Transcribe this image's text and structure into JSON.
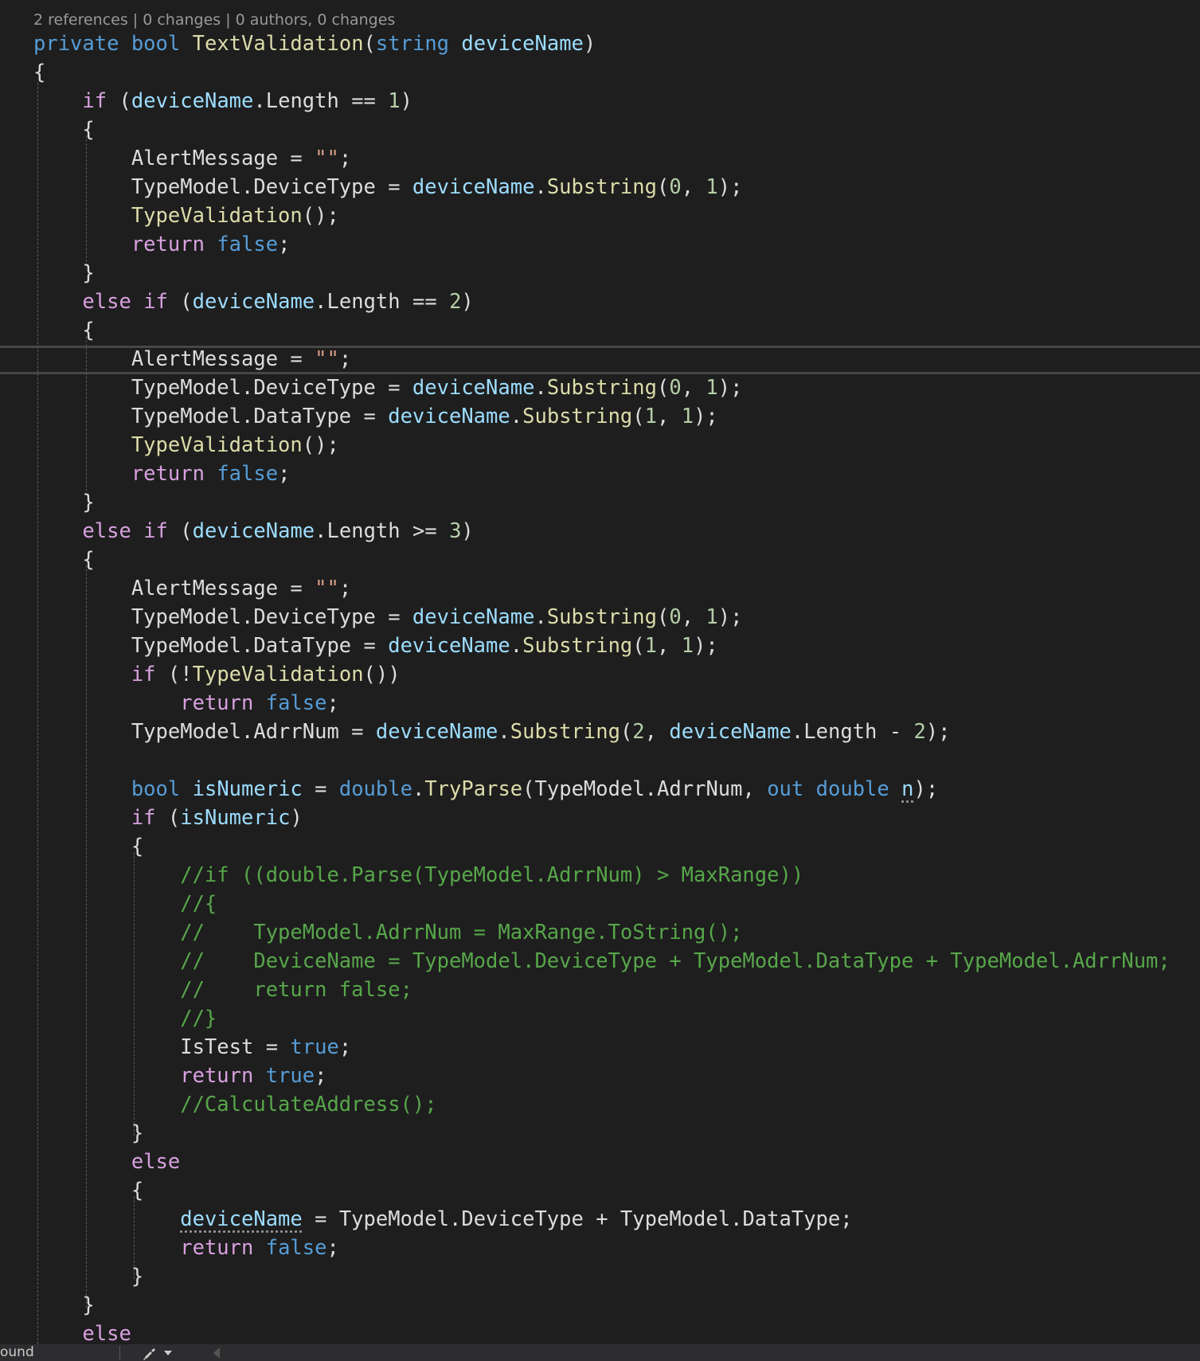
{
  "codelens": {
    "text": "2 references | 0 changes | 0 authors, 0 changes"
  },
  "code": {
    "lines": [
      [
        [
          "private",
          "k-blue"
        ],
        [
          " ",
          "k-plain"
        ],
        [
          "bool",
          "k-blue"
        ],
        [
          " ",
          "k-plain"
        ],
        [
          "TextValidation",
          "k-fn"
        ],
        [
          "(",
          "k-plain"
        ],
        [
          "string",
          "k-blue"
        ],
        [
          " ",
          "k-plain"
        ],
        [
          "deviceName",
          "k-var"
        ],
        [
          ")",
          "k-plain"
        ]
      ],
      [
        [
          "{",
          "k-plain"
        ]
      ],
      [
        [
          "    ",
          "k-plain"
        ],
        [
          "if",
          "k-purple"
        ],
        [
          " (",
          "k-plain"
        ],
        [
          "deviceName",
          "k-var"
        ],
        [
          ".Length == ",
          "k-plain"
        ],
        [
          "1",
          "k-num"
        ],
        [
          ")",
          "k-plain"
        ]
      ],
      [
        [
          "    {",
          "k-plain"
        ]
      ],
      [
        [
          "        AlertMessage = ",
          "k-plain"
        ],
        [
          "\"\"",
          "k-str"
        ],
        [
          ";",
          "k-plain"
        ]
      ],
      [
        [
          "        TypeModel.DeviceType = ",
          "k-plain"
        ],
        [
          "deviceName",
          "k-var"
        ],
        [
          ".",
          "k-plain"
        ],
        [
          "Substring",
          "k-fn"
        ],
        [
          "(",
          "k-plain"
        ],
        [
          "0",
          "k-num"
        ],
        [
          ", ",
          "k-plain"
        ],
        [
          "1",
          "k-num"
        ],
        [
          ");",
          "k-plain"
        ]
      ],
      [
        [
          "        ",
          "k-plain"
        ],
        [
          "TypeValidation",
          "k-fn"
        ],
        [
          "();",
          "k-plain"
        ]
      ],
      [
        [
          "        ",
          "k-plain"
        ],
        [
          "return",
          "k-purple"
        ],
        [
          " ",
          "k-plain"
        ],
        [
          "false",
          "k-blue"
        ],
        [
          ";",
          "k-plain"
        ]
      ],
      [
        [
          "    }",
          "k-plain"
        ]
      ],
      [
        [
          "    ",
          "k-plain"
        ],
        [
          "else",
          "k-purple"
        ],
        [
          " ",
          "k-plain"
        ],
        [
          "if",
          "k-purple"
        ],
        [
          " (",
          "k-plain"
        ],
        [
          "deviceName",
          "k-var"
        ],
        [
          ".Length == ",
          "k-plain"
        ],
        [
          "2",
          "k-num"
        ],
        [
          ")",
          "k-plain"
        ]
      ],
      [
        [
          "    {",
          "k-plain"
        ]
      ],
      [
        [
          "        AlertMessage = ",
          "k-plain"
        ],
        [
          "\"\"",
          "k-str"
        ],
        [
          ";",
          "k-plain"
        ]
      ],
      [
        [
          "        TypeModel.DeviceType = ",
          "k-plain"
        ],
        [
          "deviceName",
          "k-var"
        ],
        [
          ".",
          "k-plain"
        ],
        [
          "Substring",
          "k-fn"
        ],
        [
          "(",
          "k-plain"
        ],
        [
          "0",
          "k-num"
        ],
        [
          ", ",
          "k-plain"
        ],
        [
          "1",
          "k-num"
        ],
        [
          ");",
          "k-plain"
        ]
      ],
      [
        [
          "        TypeModel.DataType = ",
          "k-plain"
        ],
        [
          "deviceName",
          "k-var"
        ],
        [
          ".",
          "k-plain"
        ],
        [
          "Substring",
          "k-fn"
        ],
        [
          "(",
          "k-plain"
        ],
        [
          "1",
          "k-num"
        ],
        [
          ", ",
          "k-plain"
        ],
        [
          "1",
          "k-num"
        ],
        [
          ");",
          "k-plain"
        ]
      ],
      [
        [
          "        ",
          "k-plain"
        ],
        [
          "TypeValidation",
          "k-fn"
        ],
        [
          "();",
          "k-plain"
        ]
      ],
      [
        [
          "        ",
          "k-plain"
        ],
        [
          "return",
          "k-purple"
        ],
        [
          " ",
          "k-plain"
        ],
        [
          "false",
          "k-blue"
        ],
        [
          ";",
          "k-plain"
        ]
      ],
      [
        [
          "    }",
          "k-plain"
        ]
      ],
      [
        [
          "    ",
          "k-plain"
        ],
        [
          "else",
          "k-purple"
        ],
        [
          " ",
          "k-plain"
        ],
        [
          "if",
          "k-purple"
        ],
        [
          " (",
          "k-plain"
        ],
        [
          "deviceName",
          "k-var"
        ],
        [
          ".Length >= ",
          "k-plain"
        ],
        [
          "3",
          "k-num"
        ],
        [
          ")",
          "k-plain"
        ]
      ],
      [
        [
          "    {",
          "k-plain"
        ]
      ],
      [
        [
          "        AlertMessage = ",
          "k-plain"
        ],
        [
          "\"\"",
          "k-str"
        ],
        [
          ";",
          "k-plain"
        ]
      ],
      [
        [
          "        TypeModel.DeviceType = ",
          "k-plain"
        ],
        [
          "deviceName",
          "k-var"
        ],
        [
          ".",
          "k-plain"
        ],
        [
          "Substring",
          "k-fn"
        ],
        [
          "(",
          "k-plain"
        ],
        [
          "0",
          "k-num"
        ],
        [
          ", ",
          "k-plain"
        ],
        [
          "1",
          "k-num"
        ],
        [
          ");",
          "k-plain"
        ]
      ],
      [
        [
          "        TypeModel.DataType = ",
          "k-plain"
        ],
        [
          "deviceName",
          "k-var"
        ],
        [
          ".",
          "k-plain"
        ],
        [
          "Substring",
          "k-fn"
        ],
        [
          "(",
          "k-plain"
        ],
        [
          "1",
          "k-num"
        ],
        [
          ", ",
          "k-plain"
        ],
        [
          "1",
          "k-num"
        ],
        [
          ");",
          "k-plain"
        ]
      ],
      [
        [
          "        ",
          "k-plain"
        ],
        [
          "if",
          "k-purple"
        ],
        [
          " (!",
          "k-plain"
        ],
        [
          "TypeValidation",
          "k-fn"
        ],
        [
          "())",
          "k-plain"
        ]
      ],
      [
        [
          "            ",
          "k-plain"
        ],
        [
          "return",
          "k-purple"
        ],
        [
          " ",
          "k-plain"
        ],
        [
          "false",
          "k-blue"
        ],
        [
          ";",
          "k-plain"
        ]
      ],
      [
        [
          "        TypeModel.AdrrNum = ",
          "k-plain"
        ],
        [
          "deviceName",
          "k-var"
        ],
        [
          ".",
          "k-plain"
        ],
        [
          "Substring",
          "k-fn"
        ],
        [
          "(",
          "k-plain"
        ],
        [
          "2",
          "k-num"
        ],
        [
          ", ",
          "k-plain"
        ],
        [
          "deviceName",
          "k-var"
        ],
        [
          ".Length - ",
          "k-plain"
        ],
        [
          "2",
          "k-num"
        ],
        [
          ");",
          "k-plain"
        ]
      ],
      [
        [
          "",
          "k-plain"
        ]
      ],
      [
        [
          "        ",
          "k-plain"
        ],
        [
          "bool",
          "k-blue"
        ],
        [
          " ",
          "k-plain"
        ],
        [
          "isNumeric",
          "k-var"
        ],
        [
          " = ",
          "k-plain"
        ],
        [
          "double",
          "k-blue"
        ],
        [
          ".",
          "k-plain"
        ],
        [
          "TryParse",
          "k-fn"
        ],
        [
          "(TypeModel.AdrrNum, ",
          "k-plain"
        ],
        [
          "out",
          "k-blue"
        ],
        [
          " ",
          "k-plain"
        ],
        [
          "double",
          "k-blue"
        ],
        [
          " ",
          "k-plain"
        ],
        [
          "n",
          "k-var squiggle"
        ],
        [
          ");",
          "k-plain"
        ]
      ],
      [
        [
          "        ",
          "k-plain"
        ],
        [
          "if",
          "k-purple"
        ],
        [
          " (",
          "k-plain"
        ],
        [
          "isNumeric",
          "k-var"
        ],
        [
          ")",
          "k-plain"
        ]
      ],
      [
        [
          "        {",
          "k-plain"
        ]
      ],
      [
        [
          "            //if ((double.Parse(TypeModel.AdrrNum) > MaxRange))",
          "k-cmt"
        ]
      ],
      [
        [
          "            //{",
          "k-cmt"
        ]
      ],
      [
        [
          "            //    TypeModel.AdrrNum = MaxRange.ToString();",
          "k-cmt"
        ]
      ],
      [
        [
          "            //    DeviceName = TypeModel.DeviceType + TypeModel.DataType + TypeModel.AdrrNum;",
          "k-cmt"
        ]
      ],
      [
        [
          "            //    return false;",
          "k-cmt"
        ]
      ],
      [
        [
          "            //}",
          "k-cmt"
        ]
      ],
      [
        [
          "            IsTest = ",
          "k-plain"
        ],
        [
          "true",
          "k-blue"
        ],
        [
          ";",
          "k-plain"
        ]
      ],
      [
        [
          "            ",
          "k-plain"
        ],
        [
          "return",
          "k-purple"
        ],
        [
          " ",
          "k-plain"
        ],
        [
          "true",
          "k-blue"
        ],
        [
          ";",
          "k-plain"
        ]
      ],
      [
        [
          "            //CalculateAddress();",
          "k-cmt"
        ]
      ],
      [
        [
          "        }",
          "k-plain"
        ]
      ],
      [
        [
          "        ",
          "k-plain"
        ],
        [
          "else",
          "k-purple"
        ]
      ],
      [
        [
          "        {",
          "k-plain"
        ]
      ],
      [
        [
          "            ",
          "k-plain"
        ],
        [
          "deviceName",
          "k-var squiggle"
        ],
        [
          " = TypeModel.DeviceType + TypeModel.DataType;",
          "k-plain"
        ]
      ],
      [
        [
          "            ",
          "k-plain"
        ],
        [
          "return",
          "k-purple"
        ],
        [
          " ",
          "k-plain"
        ],
        [
          "false",
          "k-blue"
        ],
        [
          ";",
          "k-plain"
        ]
      ],
      [
        [
          "        }",
          "k-plain"
        ]
      ],
      [
        [
          "    }",
          "k-plain"
        ]
      ],
      [
        [
          "    ",
          "k-plain"
        ],
        [
          "else",
          "k-purple"
        ]
      ]
    ]
  },
  "statusbar": {
    "left_text": "ound",
    "icons": [
      "brush-icon",
      "dropdown-arrow-icon",
      "scroll-left-icon"
    ]
  },
  "colors": {
    "background": "#1e1e1e",
    "keyword": "#569cd6",
    "control_keyword": "#d8a0df",
    "identifier": "#9cdcfe",
    "method": "#dcdcaa",
    "number": "#b5cea8",
    "string": "#d69d85",
    "comment": "#57a64a",
    "text": "#dcdcdc"
  }
}
